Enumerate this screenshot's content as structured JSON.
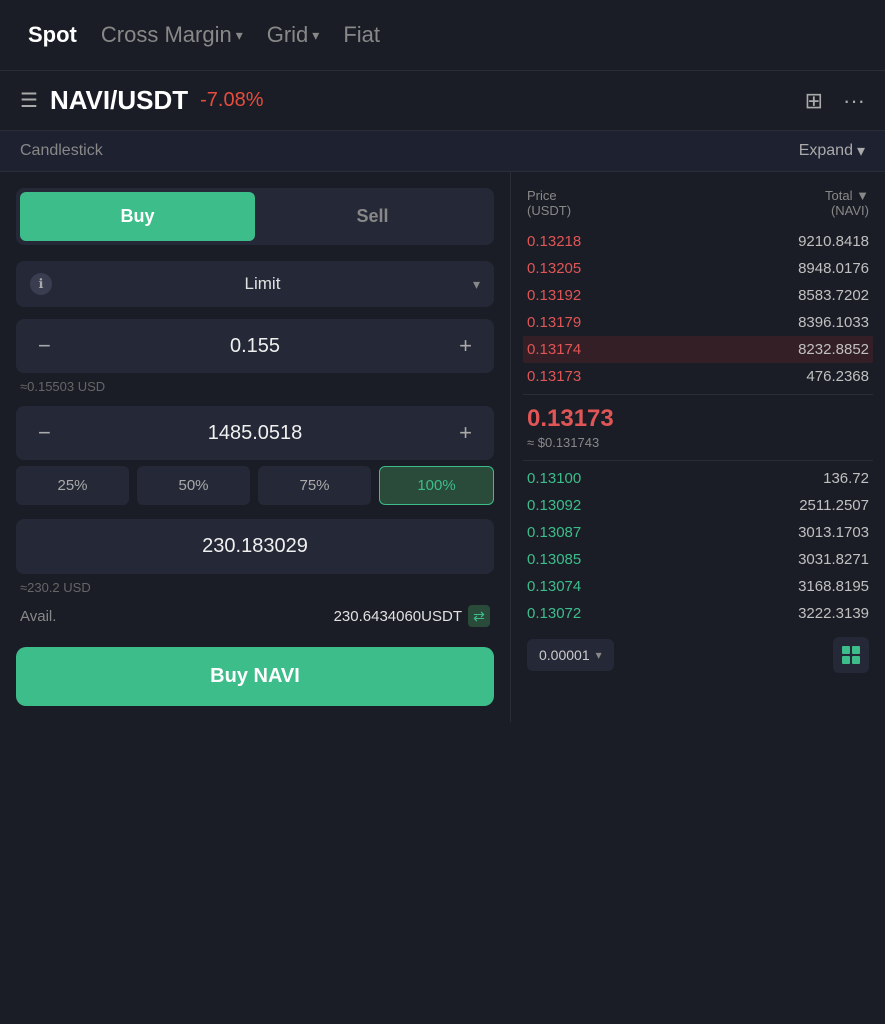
{
  "nav": {
    "spot_label": "Spot",
    "cross_margin_label": "Cross Margin",
    "grid_label": "Grid",
    "fiat_label": "Fiat"
  },
  "symbol_header": {
    "symbol": "NAVI/USDT",
    "change": "-7.08%"
  },
  "candlestick": {
    "label": "Candlestick",
    "expand": "Expand"
  },
  "order_form": {
    "buy_label": "Buy",
    "sell_label": "Sell",
    "order_type": "Limit",
    "price_value": "0.155",
    "price_hint": "≈0.15503 USD",
    "amount_value": "1485.0518",
    "pct_25": "25%",
    "pct_50": "50%",
    "pct_75": "75%",
    "pct_100": "100%",
    "total_value": "230.183029",
    "total_hint": "≈230.2 USD",
    "avail_label": "Avail.",
    "avail_value": "230.6434060USDT",
    "buy_button": "Buy NAVI"
  },
  "orderbook": {
    "col_price": "Price",
    "col_price_unit": "(USDT)",
    "col_total": "Total ▼",
    "col_total_unit": "(NAVI)",
    "sell_orders": [
      {
        "price": "0.13218",
        "total": "9210.8418"
      },
      {
        "price": "0.13205",
        "total": "8948.0176"
      },
      {
        "price": "0.13192",
        "total": "8583.7202"
      },
      {
        "price": "0.13179",
        "total": "8396.1033"
      },
      {
        "price": "0.13174",
        "total": "8232.8852"
      },
      {
        "price": "0.13173",
        "total": "476.2368"
      }
    ],
    "mid_price": "0.13173",
    "mid_price_usd": "≈ $0.131743",
    "buy_orders": [
      {
        "price": "0.13100",
        "total": "136.72"
      },
      {
        "price": "0.13092",
        "total": "2511.2507"
      },
      {
        "price": "0.13087",
        "total": "3013.1703"
      },
      {
        "price": "0.13085",
        "total": "3031.8271"
      },
      {
        "price": "0.13074",
        "total": "3168.8195"
      },
      {
        "price": "0.13072",
        "total": "3222.3139"
      }
    ],
    "tick_size": "0.00001"
  }
}
